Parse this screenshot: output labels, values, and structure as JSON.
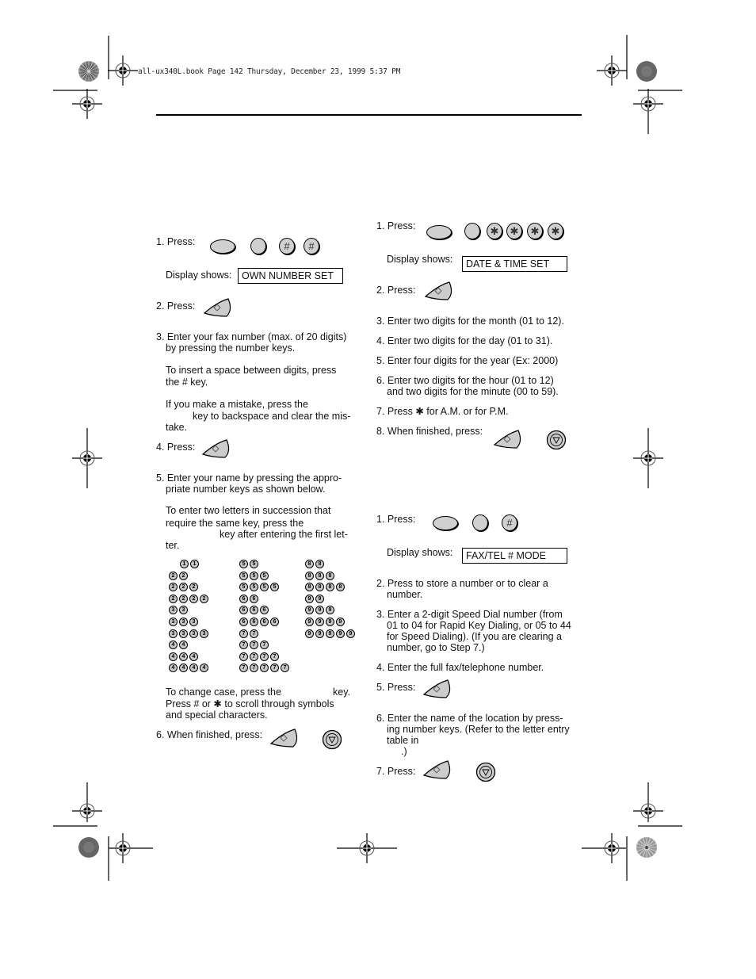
{
  "header": {
    "slug": "all-ux340L.book  Page 142  Thursday, December 23, 1999  5:37 PM"
  },
  "left_column": {
    "steps": {
      "s1_label": "1. Press:",
      "display_label": "Display shows:",
      "display_value": "OWN NUMBER SET",
      "s2_label": "2. Press:",
      "s3_line1": "3. Enter your fax number (max. of 20 digits)",
      "s3_line2": "by pressing the number keys.",
      "s3_note1_line1": "To insert  a space between digits, press",
      "s3_note1_line2": "the # key.",
      "s3_note2_line1": "If you make a mistake, press the",
      "s3_note2_line2": "key to backspace and clear the mis-",
      "s3_note2_line3": "take.",
      "s4_label": "4. Press:",
      "s5_line1": "5. Enter your name by pressing the appro-",
      "s5_line2": "priate number keys as shown below.",
      "s5_note_line1": "To enter two letters in succession that",
      "s5_note_line2": "require the same key, press the",
      "s5_note_line3": "key after entering the first let-",
      "s5_note_line4": "ter.",
      "case_line1_a": "To change case, press the",
      "case_line1_b": "key.",
      "case_line2": "Press # or ✱ to scroll through symbols",
      "case_line3": "and special characters.",
      "s6_label": "6. When finished, press:"
    },
    "s1_keys": [
      "",
      "",
      "#",
      "#"
    ],
    "letter_table": {
      "columns": [
        [
          [
            "1",
            "1"
          ],
          [
            "2",
            "2"
          ],
          [
            "2",
            "2",
            "2"
          ],
          [
            "2",
            "2",
            "2",
            "2"
          ],
          [
            "3",
            "3"
          ],
          [
            "3",
            "3",
            "3"
          ],
          [
            "3",
            "3",
            "3",
            "3"
          ],
          [
            "4",
            "4"
          ],
          [
            "4",
            "4",
            "4"
          ],
          [
            "4",
            "4",
            "4",
            "4"
          ]
        ],
        [
          [
            "5",
            "5"
          ],
          [
            "5",
            "5",
            "5"
          ],
          [
            "5",
            "5",
            "5",
            "5"
          ],
          [
            "6",
            "6"
          ],
          [
            "6",
            "6",
            "6"
          ],
          [
            "6",
            "6",
            "6",
            "6"
          ],
          [
            "7",
            "7"
          ],
          [
            "7",
            "7",
            "7"
          ],
          [
            "7",
            "7",
            "7",
            "7"
          ],
          [
            "7",
            "7",
            "7",
            "7",
            "7"
          ]
        ],
        [
          [
            "8",
            "8"
          ],
          [
            "8",
            "8",
            "8"
          ],
          [
            "8",
            "8",
            "8",
            "8"
          ],
          [
            "9",
            "9"
          ],
          [
            "9",
            "9",
            "9"
          ],
          [
            "9",
            "9",
            "9",
            "9"
          ],
          [
            "9",
            "9",
            "9",
            "9",
            "9"
          ]
        ]
      ]
    }
  },
  "right_column": {
    "date_time": {
      "s1_label": "1. Press:",
      "keys": [
        "",
        "",
        "✱",
        "✱",
        "✱",
        "✱"
      ],
      "display_label": "Display shows:",
      "display_value": "DATE & TIME SET",
      "s2_label": "2. Press:",
      "s3": "3. Enter two digits for the month (01 to 12).",
      "s4": "4. Enter two digits for the day (01 to 31).",
      "s5": "5. Enter four digits for the year (Ex: 2000)",
      "s6_line1": "6. Enter two digits for the hour (01 to 12)",
      "s6_line2": "and two digits for the minute (00 to 59).",
      "s7": "7. Press ✱ for A.M. or    for P.M.",
      "s8": "8. When finished, press:"
    },
    "speed_dial": {
      "s1_label": "1. Press:",
      "keys": [
        "",
        "",
        "#"
      ],
      "display_label": "Display shows:",
      "display_value": "FAX/TEL # MODE",
      "s2_line1": "2. Press    to store a number or    to clear a",
      "s2_line2": "number.",
      "s3_line1": "3. Enter a 2-digit Speed Dial number (from",
      "s3_line2": "01 to 04 for Rapid Key Dialing, or 05 to 44",
      "s3_line3": "for Speed Dialing). (If you are clearing a",
      "s3_line4": "number, go to Step 7.)",
      "s4": "4. Enter the full fax/telephone number.",
      "s5_label": "5. Press:",
      "s6_line1": "6. Enter the name of the location by press-",
      "s6_line2": "ing number keys. (Refer to the letter entry",
      "s6_line3": "table in",
      "s6_line4": ".)",
      "s7_label": "7. Press:"
    }
  }
}
